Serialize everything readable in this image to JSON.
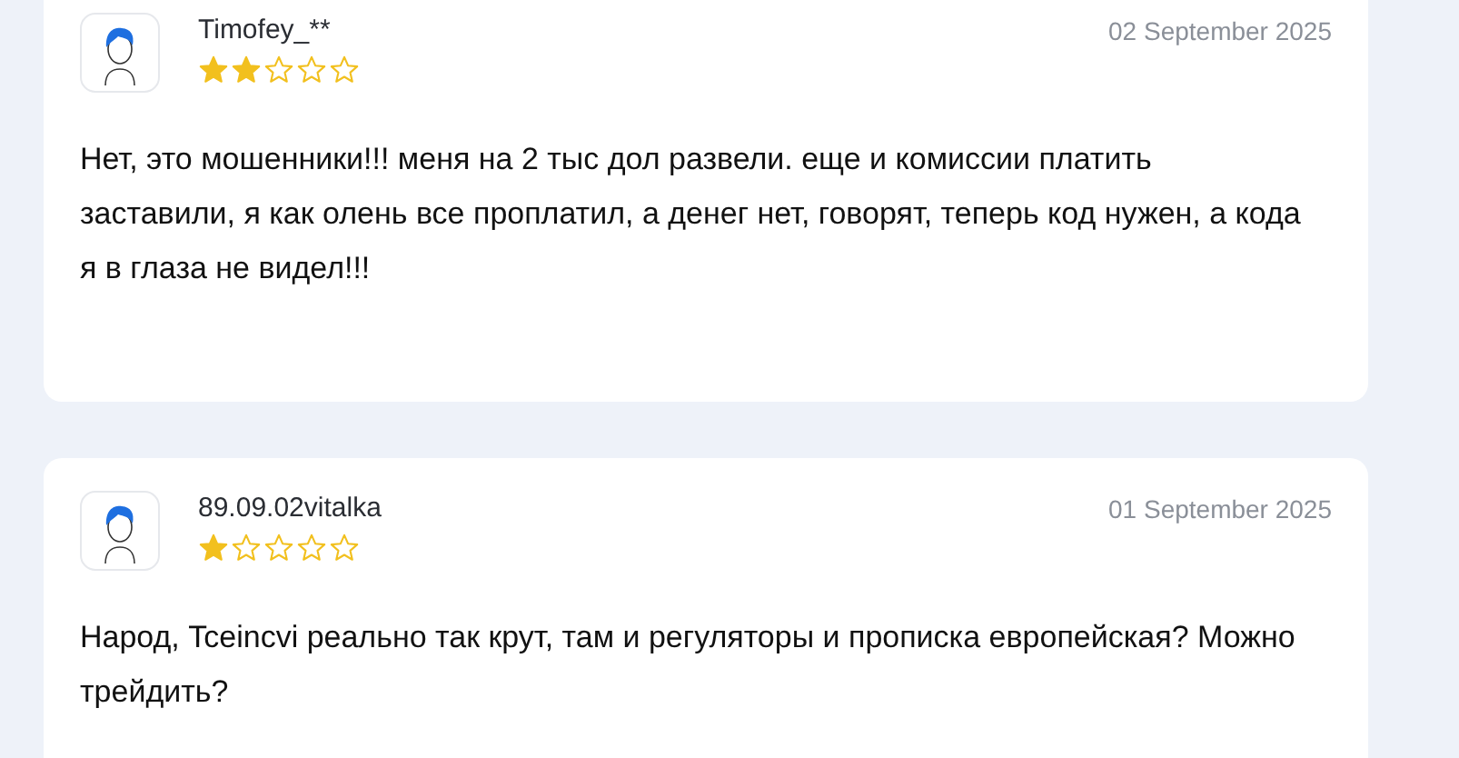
{
  "reviews": [
    {
      "author": "Timofey_**",
      "stars": 2,
      "date": "02 September 2025",
      "text": "Нет, это мошенники!!! меня на 2 тыс дол развели. еще и комиссии платить заставили, я как олень все проплатил, а денег нет, говорят, теперь код нужен, а кода я в глаза не видел!!!"
    },
    {
      "author": "89.09.02vitalka",
      "stars": 1,
      "date": "01 September 2025",
      "text": "Народ, Tceincvi реально так крут, там и регуляторы и прописка европейская? Можно трейдить?"
    }
  ]
}
